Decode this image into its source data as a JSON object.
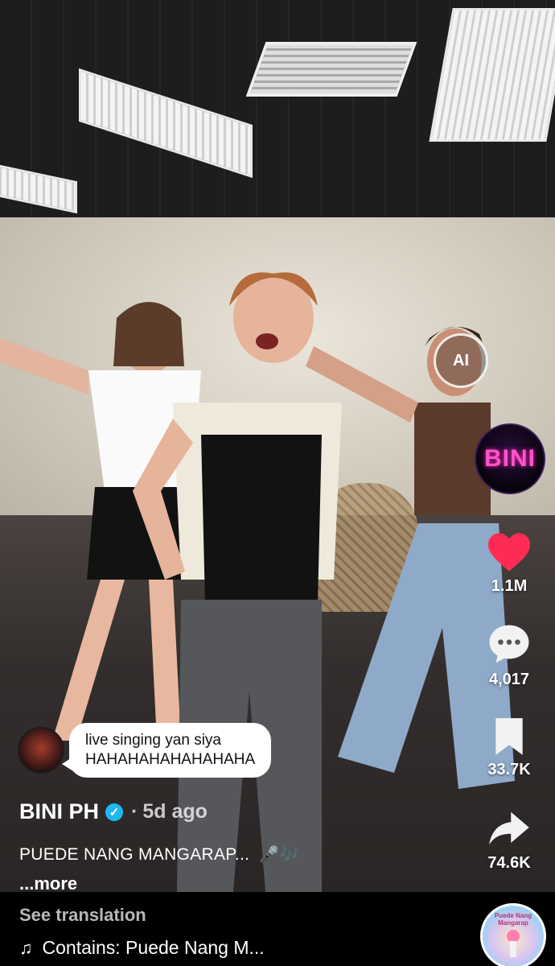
{
  "side_rail": {
    "ai_label": "AI",
    "profile_label": "BINI",
    "like_count": "1.1M",
    "comment_count": "4,017",
    "save_count": "33.7K",
    "share_count": "74.6K",
    "like_color": "#fe2c55"
  },
  "comment_popup": {
    "text_line1": "live singing yan siya",
    "text_line2": "HAHAHAHAHAHAHAHA"
  },
  "post": {
    "author": "BINI PH",
    "separator": "·",
    "time_ago": "5d ago",
    "caption": "PUEDE NANG MANGARAP...",
    "caption_emoji": "🎤🎶",
    "more_label": "...more"
  },
  "footer": {
    "see_translation": "See translation",
    "music_text": "Contains: Puede Nang M...",
    "disc_label": "Puede Nang Mangarap"
  }
}
